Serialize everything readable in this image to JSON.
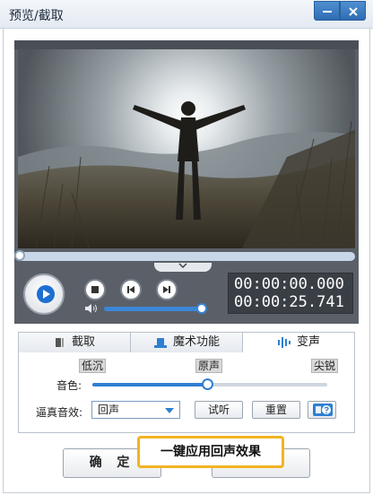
{
  "window": {
    "title": "预览/截取",
    "minimize_label": "—",
    "close_label": "✕"
  },
  "player": {
    "current_time": "00:00:00.000",
    "total_time": "00:00:25.741",
    "seek_progress": 0.0,
    "volume_level": 1.0,
    "icons": {
      "play": "play-icon",
      "stop": "stop-icon",
      "prev": "prev-frame-icon",
      "next": "next-frame-icon",
      "volume": "speaker-icon",
      "collapse": "chevron-down-icon"
    }
  },
  "tabs": [
    {
      "label": "截取",
      "icon": "crop-icon"
    },
    {
      "label": "魔术功能",
      "icon": "magic-hat-icon"
    },
    {
      "label": "变声",
      "icon": "voice-wave-icon",
      "active": true
    }
  ],
  "voice_panel": {
    "tone_label": "音色:",
    "scale_low": "低沉",
    "scale_mid": "原声",
    "scale_high": "尖锐",
    "tone_level": 0.5,
    "effect_label": "逼真音效:",
    "effect_value": "回声",
    "preview_button": "试听",
    "reset_button": "重置",
    "help_icon": "help-icon"
  },
  "footer": {
    "confirm_button": "确 定"
  },
  "tooltip": {
    "text": "一键应用回声效果"
  },
  "colors": {
    "accent": "#2f7fd2",
    "title_button": "#3a7cc4",
    "tooltip_border": "#f2b323"
  }
}
